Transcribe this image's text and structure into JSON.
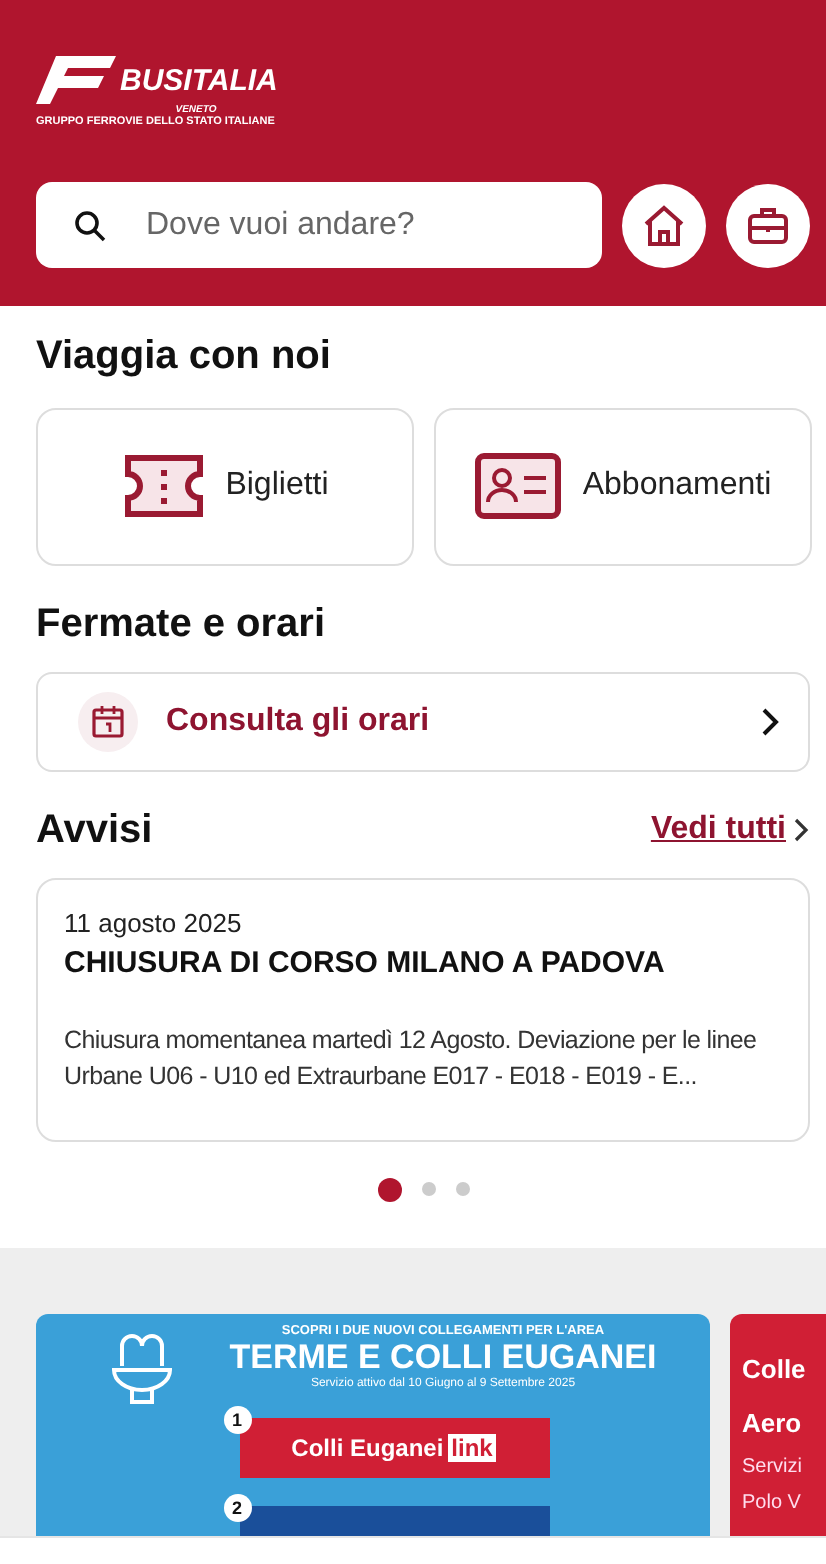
{
  "header": {
    "logo": {
      "brand": "BUSITALIA",
      "region": "VENETO",
      "group": "GRUPPO FERROVIE DELLO STATO ITALIANE"
    },
    "search": {
      "placeholder": "Dove vuoi andare?"
    }
  },
  "travel": {
    "title": "Viaggia con noi",
    "tiles": [
      {
        "kind": "ticket",
        "label": "Biglietti"
      },
      {
        "kind": "pass",
        "label": "Abbonamenti"
      }
    ]
  },
  "timetables": {
    "title": "Fermate e orari",
    "link": "Consulta gli orari"
  },
  "notices": {
    "title": "Avvisi",
    "see_all": "Vedi tutti",
    "card": {
      "date": "11 agosto 2025",
      "headline": "CHIUSURA DI CORSO MILANO A PADOVA",
      "body": "Chiusura momentanea martedì 12 Agosto. Deviazione per le linee Urbane U06 - U10 ed Extraurbane E017 - E018 - E019 - E..."
    },
    "pager": [
      {
        "selected": true
      },
      {
        "selected": false
      },
      {
        "selected": false
      }
    ]
  },
  "banners": [
    {
      "kind": "promo",
      "kicker": "SCOPRI I DUE NUOVI COLLEGAMENTI PER L'AREA",
      "title": "TERME E COLLI EUGANEI",
      "subtitle": "Servizio attivo dal 10 Giugno al 9 Settembre 2025",
      "items": [
        {
          "number": "1",
          "label": "Colli Euganei",
          "tag": "link"
        },
        {
          "number": "2"
        }
      ]
    },
    {
      "kind": "plain",
      "lines": [
        "Colle",
        "Aero"
      ],
      "body": [
        "Servizi",
        "Polo V"
      ]
    }
  ]
}
